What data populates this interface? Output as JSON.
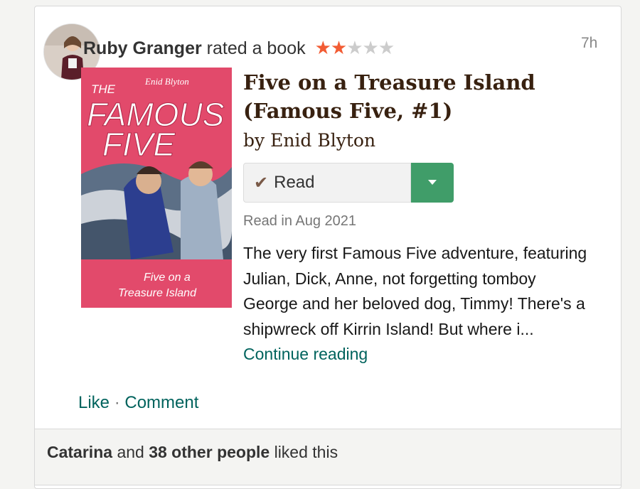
{
  "post": {
    "user": "Ruby Granger",
    "action": "rated a book",
    "rating": 2,
    "rating_max": 5,
    "time": "7h"
  },
  "book": {
    "title": "Five on a Treasure Island (Famous Five, #1)",
    "author_line": "by Enid Blyton",
    "cover": {
      "brand": "Enid Blyton",
      "series_top": "THE",
      "series_main": "FAMOUS",
      "series_second": "FIVE",
      "subtitle_line1": "Five on a",
      "subtitle_line2": "Treasure Island"
    },
    "shelf_label": "Read",
    "read_date": "Read in Aug 2021",
    "description": "The very first Famous Five adventure, featuring Julian, Dick, Anne, not forgetting tomboy George and her beloved dog, Timmy! There's a shipwreck off Kirrin Island! But where i...",
    "continue_label": "Continue reading"
  },
  "actions": {
    "like": "Like",
    "separator": "·",
    "comment": "Comment"
  },
  "likes": {
    "first_user": "Catarina",
    "joiner": "and",
    "others": "38 other people",
    "suffix": "liked this"
  },
  "colors": {
    "accent_green": "#00635d",
    "button_green": "#409d69",
    "star_orange": "#f25c34",
    "cover_pink": "#e24a6b"
  },
  "icons": {
    "shelf_check": "check-icon",
    "dropdown": "caret-down-icon"
  }
}
